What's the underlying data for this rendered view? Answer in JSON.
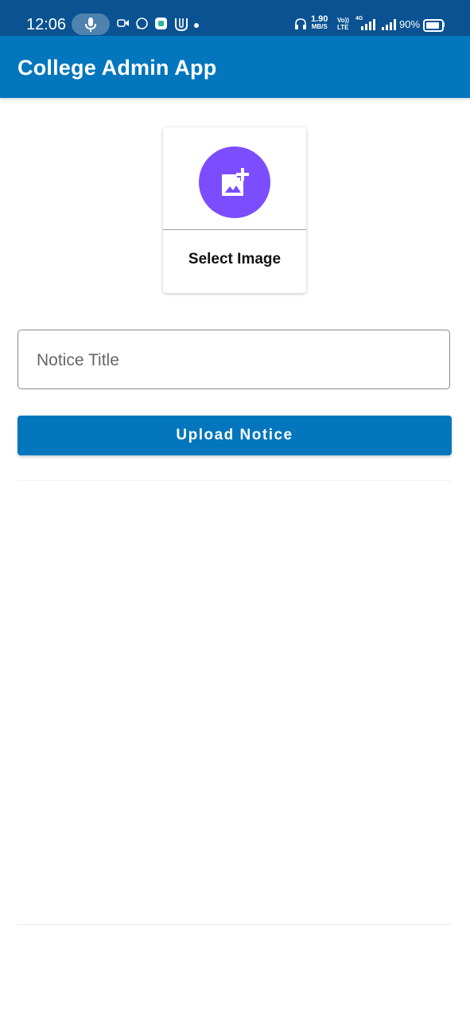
{
  "status_bar": {
    "time": "12:06",
    "net_speed_value": "1.90",
    "net_speed_unit": "MB/S",
    "volte_top": "Vo))",
    "volte_bottom": "LTE",
    "network_label": "4G",
    "battery_pct": "90%"
  },
  "app_bar": {
    "title": "College Admin App"
  },
  "image_card": {
    "label": "Select Image",
    "accent": "#7c4dff"
  },
  "notice_form": {
    "title_placeholder": "Notice Title",
    "title_value": "",
    "upload_label": "Upload Notice"
  },
  "colors": {
    "primary": "#0376bd",
    "status_bar": "#0a5291"
  }
}
